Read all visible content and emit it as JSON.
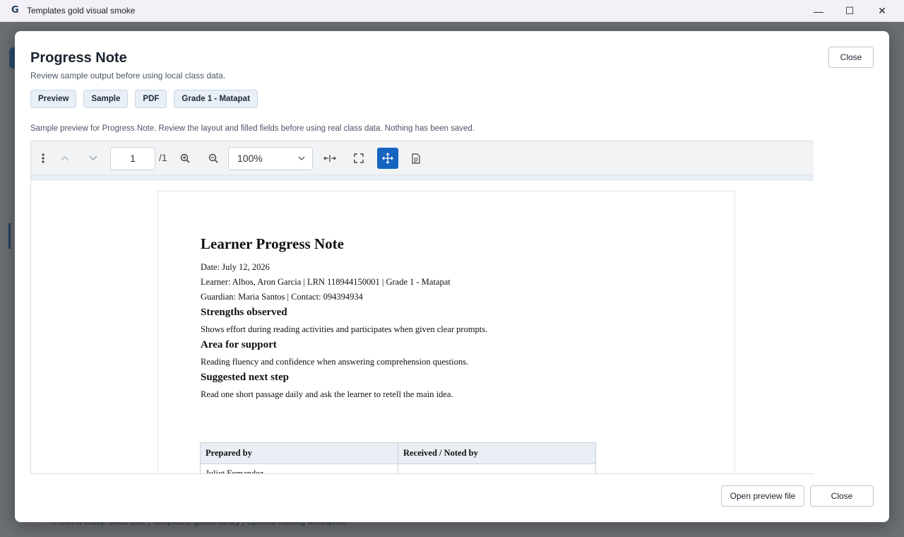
{
  "window": {
    "title": "Templates gold visual smoke",
    "app_icon_glyph": "G",
    "controls": {
      "minimize": "—",
      "maximize": "☐",
      "close": "✕"
    }
  },
  "background_app": {
    "status_bar": "Preview ready. Class List:  |  Templates: global library  |  Opened existing workspace"
  },
  "dialog": {
    "title": "Progress Note",
    "subtitle": "Review sample output before using local class data.",
    "close_label": "Close",
    "chips": [
      "Preview",
      "Sample",
      "PDF",
      "Grade 1 - Matapat"
    ],
    "notice": "Sample preview for Progress Note. Review the layout and filled fields before using real class data. Nothing has been saved.",
    "footer": {
      "open_preview_label": "Open preview file",
      "close_label": "Close"
    }
  },
  "viewer": {
    "page_current": "1",
    "page_total": "/1",
    "zoom": "100%",
    "icons": [
      "more-vertical-icon",
      "chevron-up-icon",
      "chevron-down-icon",
      "zoom-in-icon",
      "zoom-out-icon",
      "fit-width-icon",
      "fullscreen-icon",
      "pan-tool-icon",
      "document-properties-icon"
    ]
  },
  "document": {
    "title": "Learner Progress Note",
    "date_line": "Date: July 12, 2026",
    "learner_line": "Learner: Albos, Aron Garcia | LRN 118944150001 | Grade 1 - Matapat",
    "guardian_line": "Guardian: Maria Santos | Contact: 094394934",
    "sections": [
      {
        "heading": "Strengths observed",
        "body": "Shows effort during reading activities and participates when given clear prompts."
      },
      {
        "heading": "Area for support",
        "body": "Reading fluency and confidence when answering comprehension questions."
      },
      {
        "heading": "Suggested next step",
        "body": "Read one short passage daily and ask the learner to retell the main idea."
      }
    ],
    "signature_table": {
      "headers": [
        "Prepared by",
        "Received / Noted by"
      ],
      "row": [
        "Juliet Fernandez",
        ""
      ]
    }
  }
}
